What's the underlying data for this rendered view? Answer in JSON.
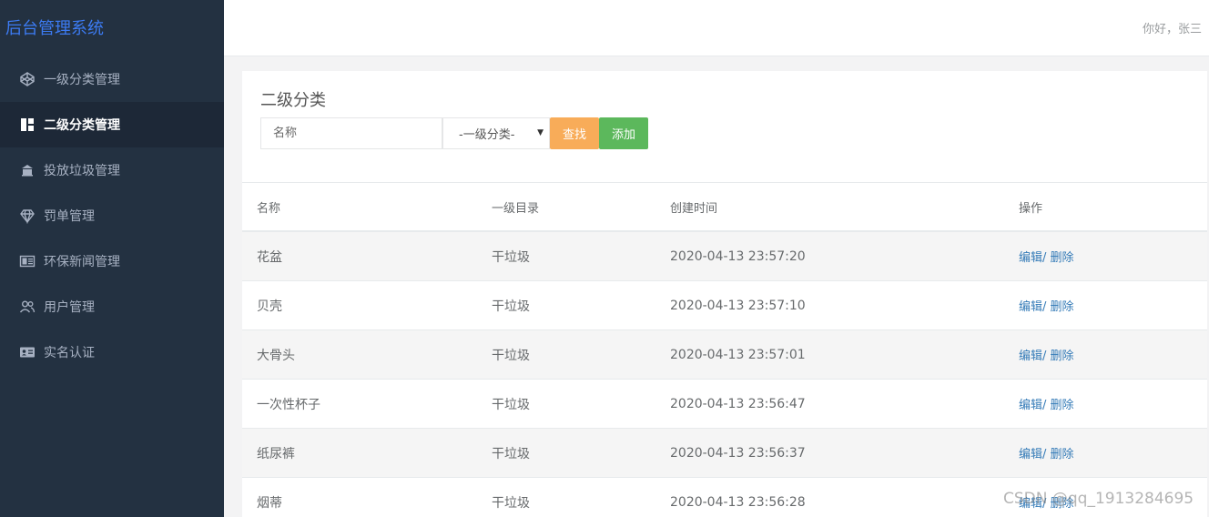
{
  "app": {
    "title": "后台管理系统"
  },
  "header": {
    "greeting": "你好，张三"
  },
  "sidebar": {
    "items": [
      {
        "label": "一级分类管理",
        "icon": "codepen-icon"
      },
      {
        "label": "二级分类管理",
        "icon": "dashboard-grid-icon",
        "active": true
      },
      {
        "label": "投放垃圾管理",
        "icon": "bank-icon"
      },
      {
        "label": "罚单管理",
        "icon": "diamond-icon"
      },
      {
        "label": "环保新闻管理",
        "icon": "newspaper-icon"
      },
      {
        "label": "用户管理",
        "icon": "users-icon"
      },
      {
        "label": "实名认证",
        "icon": "id-card-icon"
      }
    ]
  },
  "main": {
    "title": "二级分类",
    "search": {
      "placeholder": "名称",
      "value": ""
    },
    "category_select": {
      "selected": "-一级分类-"
    },
    "search_button": "查找",
    "add_button": "添加",
    "table": {
      "headers": [
        "名称",
        "一级目录",
        "创建时间",
        "操作"
      ],
      "rows": [
        {
          "name": "花盆",
          "category": "干垃圾",
          "created": "2020-04-13 23:57:20"
        },
        {
          "name": "贝壳",
          "category": "干垃圾",
          "created": "2020-04-13 23:57:10"
        },
        {
          "name": "大骨头",
          "category": "干垃圾",
          "created": "2020-04-13 23:57:01"
        },
        {
          "name": "一次性杯子",
          "category": "干垃圾",
          "created": "2020-04-13 23:56:47"
        },
        {
          "name": "纸尿裤",
          "category": "干垃圾",
          "created": "2020-04-13 23:56:37"
        },
        {
          "name": "烟蒂",
          "category": "干垃圾",
          "created": "2020-04-13 23:56:28"
        }
      ],
      "actions": {
        "edit": "编辑",
        "separator": "/",
        "delete": " 删除"
      }
    }
  },
  "watermark": "CSDN @qq_1913284695",
  "colors": {
    "sidebar_bg": "#233141",
    "brand": "#3c7bf3",
    "search_btn": "#f8ac59",
    "add_btn": "#5cb85c",
    "link": "#337ab7"
  }
}
